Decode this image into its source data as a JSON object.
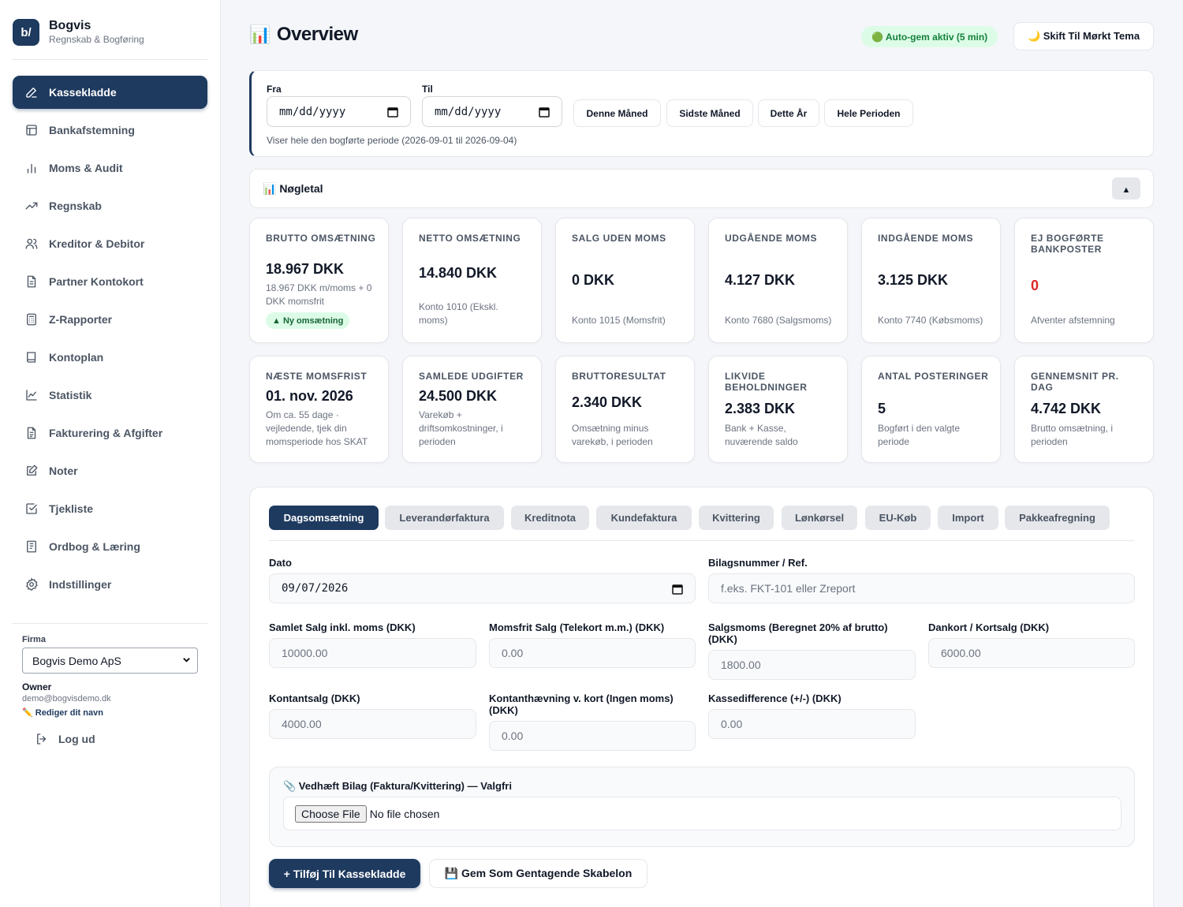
{
  "brand": {
    "logo_text": "b/",
    "name": "Bogvis",
    "tagline": "Regnskab & Bogføring"
  },
  "sidebar": {
    "items": [
      {
        "label": "Kassekladde",
        "icon": "pencil-icon",
        "active": true
      },
      {
        "label": "Bankafstemning",
        "icon": "layout-icon"
      },
      {
        "label": "Moms & Audit",
        "icon": "bar-chart-icon"
      },
      {
        "label": "Regnskab",
        "icon": "trending-up-icon"
      },
      {
        "label": "Kreditor & Debitor",
        "icon": "users-icon"
      },
      {
        "label": "Partner Kontokort",
        "icon": "document-icon"
      },
      {
        "label": "Z-Rapporter",
        "icon": "calculator-icon"
      },
      {
        "label": "Kontoplan",
        "icon": "book-icon"
      },
      {
        "label": "Statistik",
        "icon": "line-chart-icon"
      },
      {
        "label": "Fakturering & Afgifter",
        "icon": "invoice-icon"
      },
      {
        "label": "Noter",
        "icon": "edit-icon"
      },
      {
        "label": "Tjekliste",
        "icon": "checkbox-icon"
      },
      {
        "label": "Ordbog & Læring",
        "icon": "book-open-icon"
      },
      {
        "label": "Indstillinger",
        "icon": "gear-icon"
      }
    ],
    "firma_label": "Firma",
    "firma_selected": "Bogvis Demo ApS",
    "owner_role": "Owner",
    "owner_email": "demo@bogvisdemo.dk",
    "edit_name": "✏️ Rediger dit navn",
    "logout": "Log ud"
  },
  "header": {
    "icon": "📊",
    "title": "Overview",
    "autosave": "🟢 Auto-gem aktiv (5 min)",
    "theme_button": "🌙  Skift Til Mørkt Tema"
  },
  "period": {
    "from_label": "Fra",
    "to_label": "Til",
    "from_value": "mm/dd/yyyy",
    "to_value": "mm/dd/yyyy",
    "buttons": [
      "Denne Måned",
      "Sidste Måned",
      "Dette År",
      "Hele Perioden"
    ],
    "note": "Viser hele den bogførte periode (2026-09-01 til 2026-09-04)"
  },
  "kpi_section": {
    "title": "📊 Nøgletal",
    "collapse": "▲"
  },
  "kpis_row1": [
    {
      "title": "Brutto omsætning",
      "value": "18.967 DKK",
      "desc": "18.967 DKK m/moms + 0 DKK momsfrit",
      "badge": "▲ Ny omsætning"
    },
    {
      "title": "Netto omsætning",
      "value": "14.840 DKK",
      "desc": "Konto 1010 (Ekskl. moms)"
    },
    {
      "title": "Salg uden moms",
      "value": "0 DKK",
      "desc": "Konto 1015 (Momsfrit)"
    },
    {
      "title": "Udgående moms",
      "value": "4.127 DKK",
      "desc": "Konto 7680 (Salgsmoms)"
    },
    {
      "title": "Indgående moms",
      "value": "3.125 DKK",
      "desc": "Konto 7740 (Købsmoms)"
    },
    {
      "title": "Ej bogførte bankposter",
      "value": "0",
      "desc": "Afventer afstemning"
    }
  ],
  "kpis_row2": [
    {
      "title": "Næste momsfrist",
      "value": "01. nov. 2026",
      "desc": "Om ca. 55 dage · vejledende, tjek din momsperiode hos SKAT"
    },
    {
      "title": "Samlede udgifter",
      "value": "24.500 DKK",
      "desc": "Varekøb + driftsomkostninger, i perioden"
    },
    {
      "title": "Bruttoresultat",
      "value": "2.340 DKK",
      "desc": "Omsætning minus varekøb, i perioden"
    },
    {
      "title": "Likvide beholdninger",
      "value": "2.383 DKK",
      "desc": "Bank + Kasse, nuværende saldo"
    },
    {
      "title": "Antal posteringer",
      "value": "5",
      "desc": "Bogført i den valgte periode"
    },
    {
      "title": "Gennemsnit pr. dag",
      "value": "4.742 DKK",
      "desc": "Brutto omsætning, i perioden"
    }
  ],
  "tabs": [
    "Dagsomsætning",
    "Leverandørfaktura",
    "Kreditnota",
    "Kundefaktura",
    "Kvittering",
    "Lønkørsel",
    "EU-Køb",
    "Import",
    "Pakkeafregning"
  ],
  "form": {
    "dato_label": "Dato",
    "dato_value": "09/07/2026",
    "bilag_label": "Bilagsnummer / Ref.",
    "bilag_placeholder": "f.eks. FKT-101 eller Zreport",
    "samlet_label": "Samlet Salg inkl. moms (DKK)",
    "samlet_value": "10000.00",
    "momsfrit_label": "Momsfrit Salg (Telekort m.m.) (DKK)",
    "momsfrit_value": "0.00",
    "salgsmoms_label": "Salgsmoms (Beregnet 20% af brutto) (DKK)",
    "salgsmoms_value": "1800.00",
    "dankort_label": "Dankort / Kortsalg (DKK)",
    "dankort_value": "6000.00",
    "kontant_label": "Kontantsalg (DKK)",
    "kontant_value": "4000.00",
    "haevning_label": "Kontanthævning v. kort (Ingen moms) (DKK)",
    "haevning_value": "0.00",
    "kassediff_label": "Kassedifference (+/-) (DKK)",
    "kassediff_value": "0.00",
    "attach_label": "📎 Vedhæft Bilag (Faktura/Kvittering) — Valgfri",
    "choose_file": "Choose File",
    "no_file": "No file chosen",
    "add_button": "+ Tilføj Til Kassekladde",
    "template_button": "💾 Gem Som Gentagende Skabelon"
  },
  "colors": {
    "primary": "#1e3a5f",
    "success_bg": "#dcfce7",
    "success_text": "#15803d",
    "danger": "#dc2626"
  }
}
